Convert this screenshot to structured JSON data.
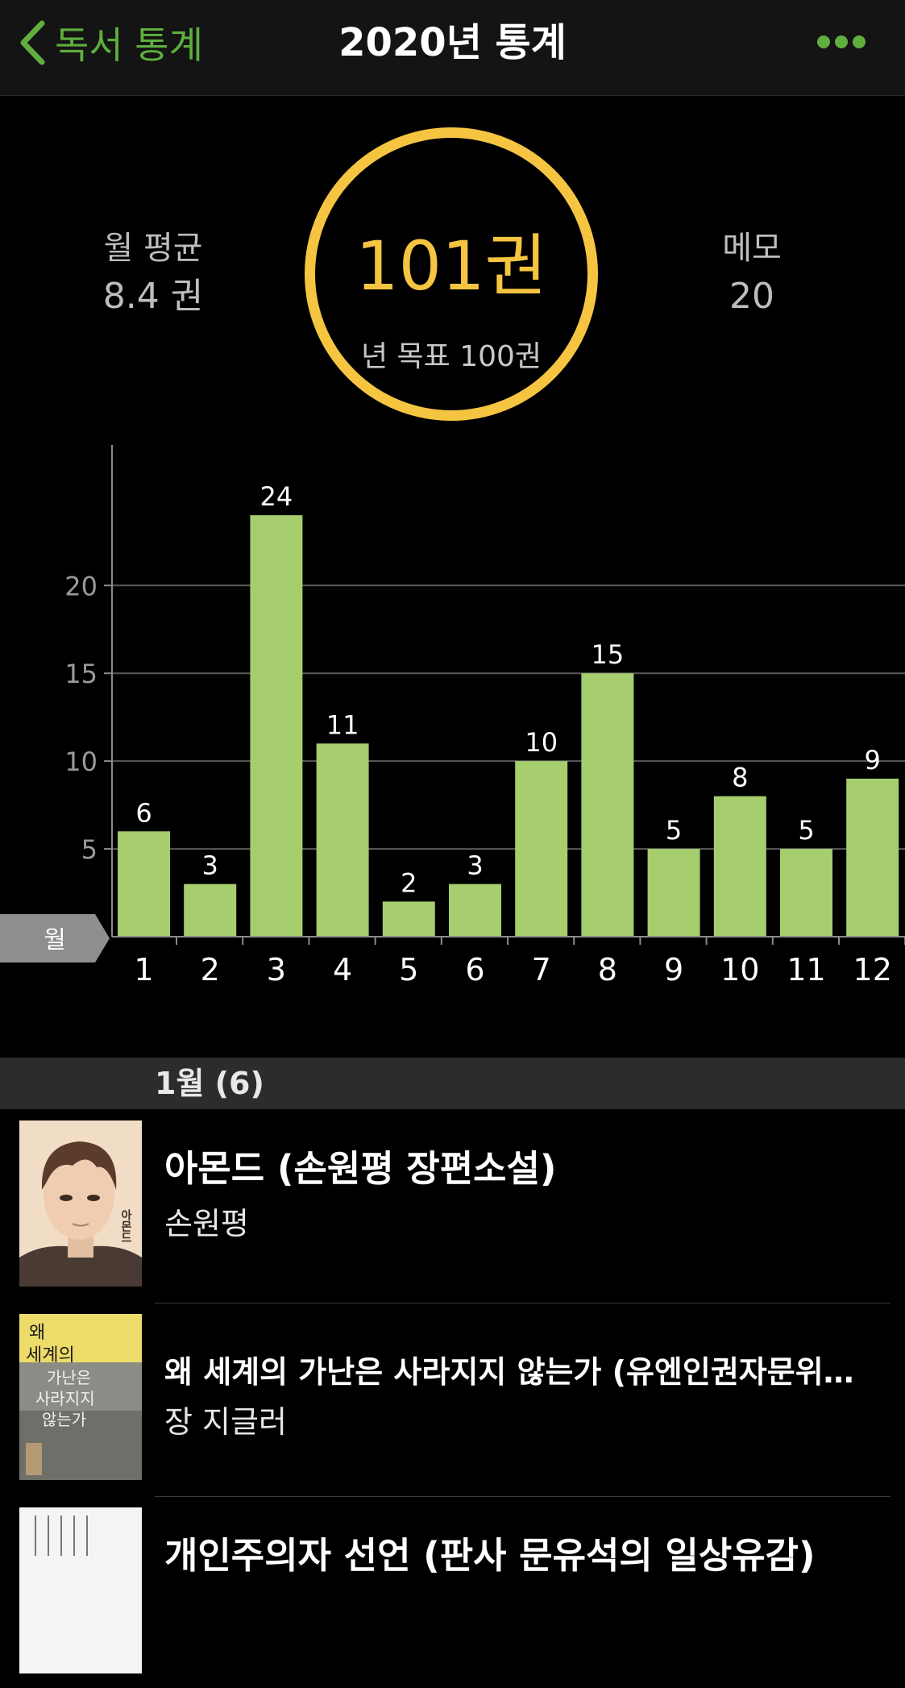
{
  "nav": {
    "back_label": "독서 통계",
    "title": "2020년 통계"
  },
  "summary": {
    "monthly_avg_label": "월 평균",
    "monthly_avg_value": "8.4 권",
    "total_count": "101권",
    "goal_text": "년 목표 100권",
    "memo_label": "메모",
    "memo_value": "20"
  },
  "colors": {
    "accent": "#5fae3e",
    "ring": "#f5c542",
    "bar": "#a6cd6e",
    "section_bg": "#2c2c2c"
  },
  "chart_data": {
    "type": "bar",
    "categories": [
      "1",
      "2",
      "3",
      "4",
      "5",
      "6",
      "7",
      "8",
      "9",
      "10",
      "11",
      "12"
    ],
    "values": [
      6,
      3,
      24,
      11,
      2,
      3,
      10,
      15,
      5,
      8,
      5,
      9
    ],
    "xlabel": "월",
    "ylabel": "",
    "ylim": [
      0,
      28
    ],
    "yticks": [
      5,
      10,
      15,
      20
    ],
    "grid": true
  },
  "section": {
    "title": "1월 (6)"
  },
  "books": [
    {
      "title": "아몬드 (손원평 장편소설)",
      "author": "손원평",
      "cover_icon": "almond-cover"
    },
    {
      "title": "왜 세계의 가난은 사라지지 않는가 (유엔인권자문위…",
      "author": "장 지글러",
      "cover_icon": "poverty-cover",
      "cover_title": [
        "왜",
        "세계의",
        "가난은",
        "사라지지",
        "않는가"
      ]
    },
    {
      "title": "개인주의자 선언 (판사 문유석의 일상유감)",
      "author": "",
      "cover_icon": "individualist-cover"
    }
  ]
}
